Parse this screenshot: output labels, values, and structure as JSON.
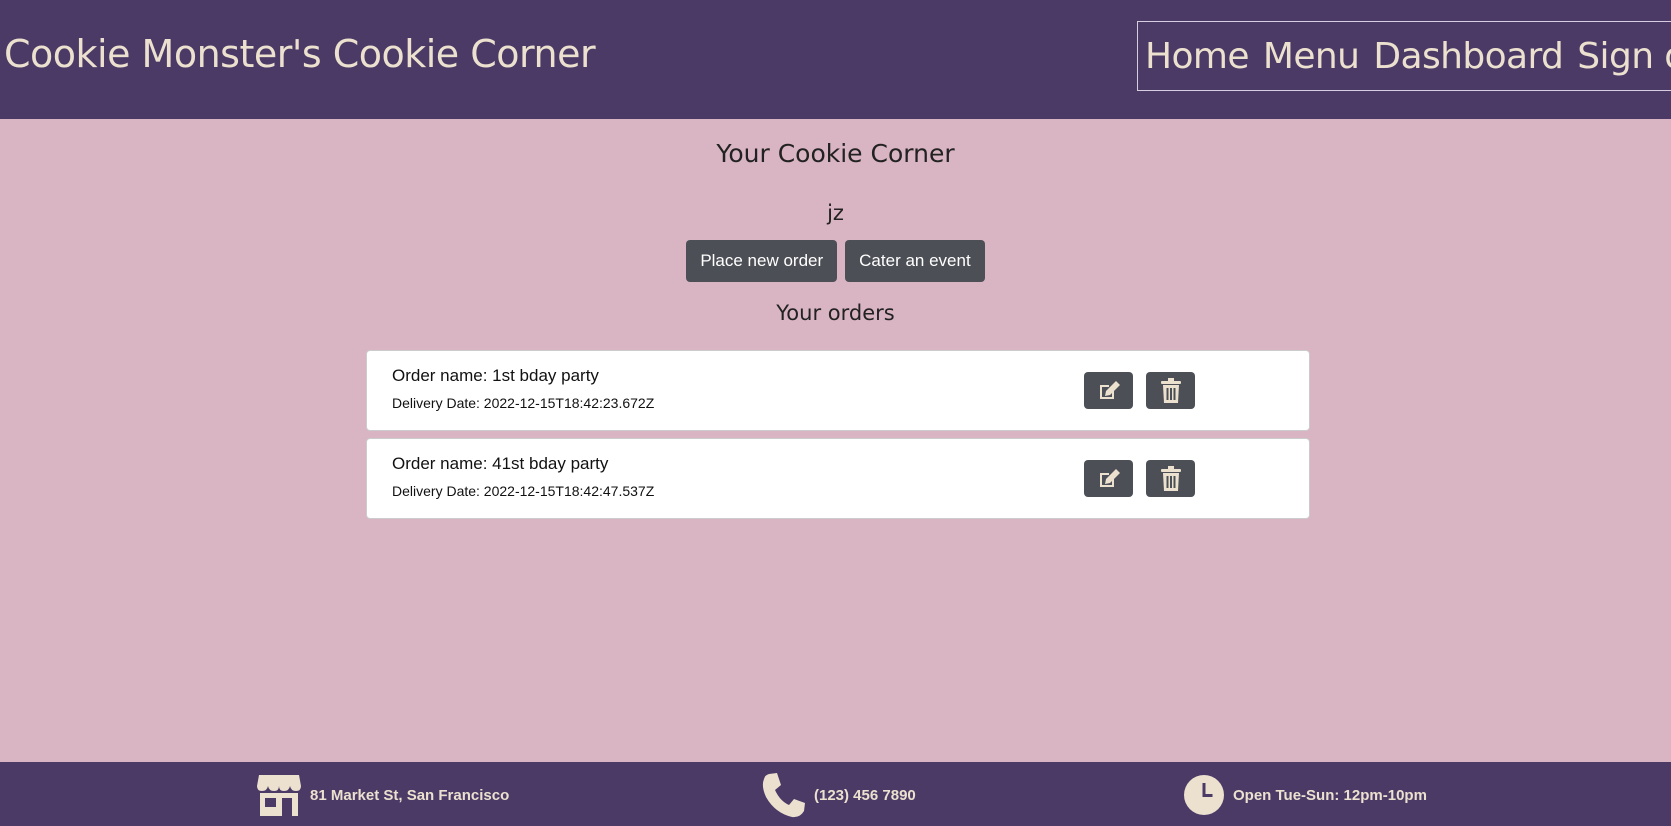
{
  "header": {
    "brand": "Cookie Monster's Cookie Corner",
    "nav": [
      "Home",
      "Menu",
      "Dashboard",
      "Sign out"
    ]
  },
  "main": {
    "title": "Your Cookie Corner",
    "username": "jz",
    "place_order_label": "Place new order",
    "cater_label": "Cater an event",
    "orders_title": "Your orders",
    "orders": [
      {
        "name": "Order name: 1st bday party",
        "date": "Delivery Date: 2022-12-15T18:42:23.672Z"
      },
      {
        "name": "Order name: 41st bday party",
        "date": "Delivery Date: 2022-12-15T18:42:47.537Z"
      }
    ]
  },
  "footer": {
    "address": "81 Market St, San Francisco",
    "phone": "(123) 456 7890",
    "hours": "Open Tue-Sun: 12pm-10pm"
  },
  "colors": {
    "header_bg": "#4b3a66",
    "page_bg": "#d9b4c2",
    "button_bg": "#4c4f55",
    "cream": "#ece0cf"
  },
  "icons": {
    "edit": "pencil-square-icon",
    "delete": "trash-icon",
    "store": "store-icon",
    "phone": "phone-icon",
    "clock": "clock-icon"
  }
}
